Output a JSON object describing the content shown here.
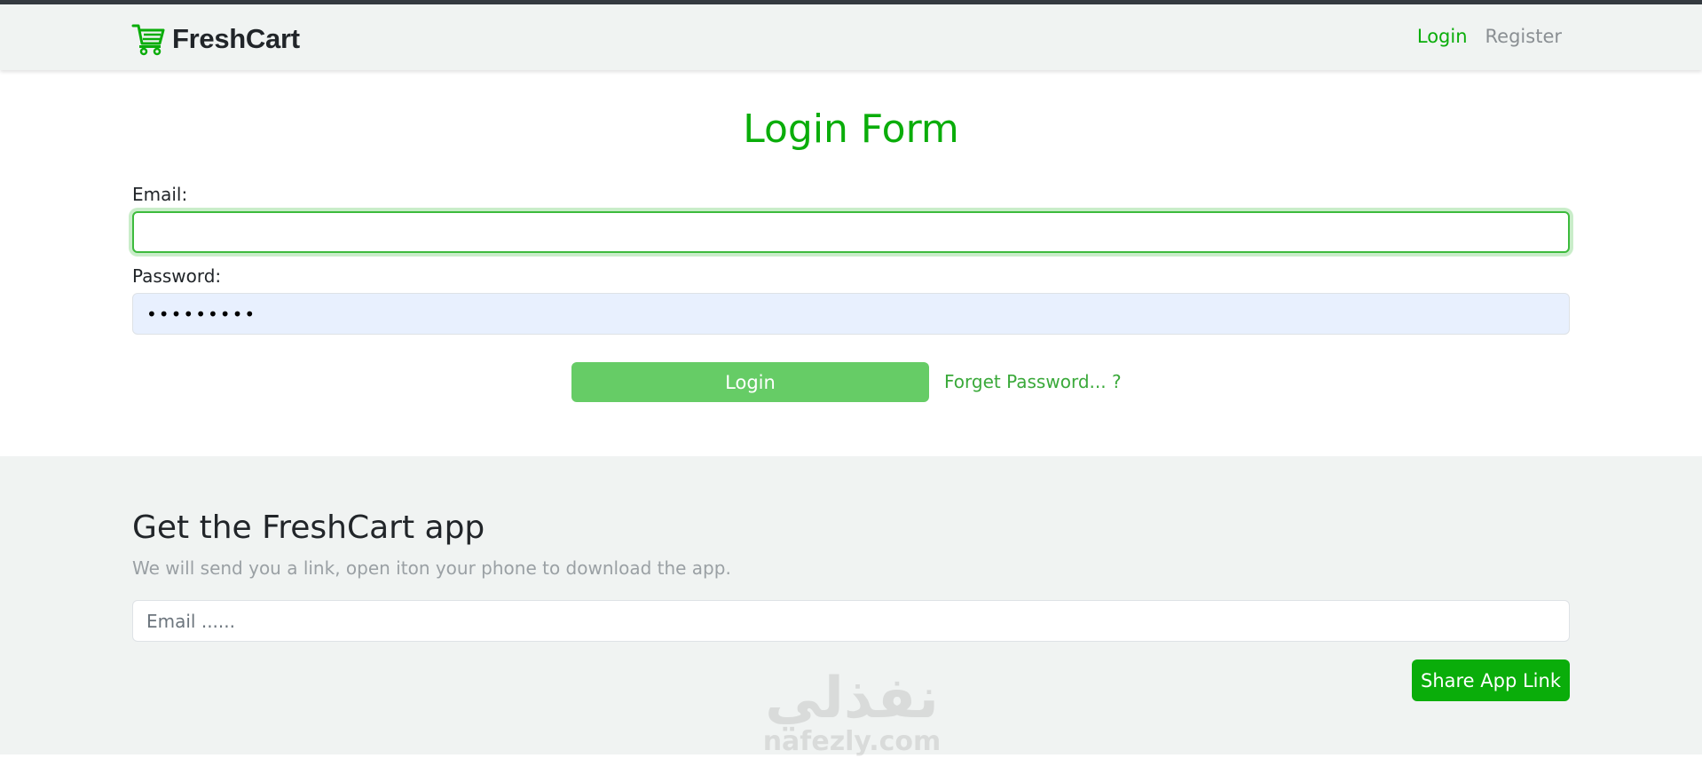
{
  "navbar": {
    "brand": "FreshCart",
    "brand_icon": "cart-icon",
    "links": [
      {
        "label": "Login",
        "active": true
      },
      {
        "label": "Register",
        "active": false
      }
    ]
  },
  "login_form": {
    "title": "Login Form",
    "email_label": "Email:",
    "email_value": "",
    "password_label": "Password:",
    "password_value": "•••••••••",
    "submit_label": "Login",
    "forget_label": "Forget Password... ?"
  },
  "app_section": {
    "title": "Get the FreshCart app",
    "subtitle": "We will send you a link, open iton your phone to download the app.",
    "email_placeholder": "Email ......",
    "share_label": "Share App Link"
  },
  "watermark": {
    "arabic": "نفذلي",
    "domain": "nafezly.com"
  },
  "colors": {
    "accent": "#0aad0a",
    "light_bg": "#f0f3f2",
    "login_button": "#66cc66",
    "autofill_bg": "#e8f0fe"
  }
}
